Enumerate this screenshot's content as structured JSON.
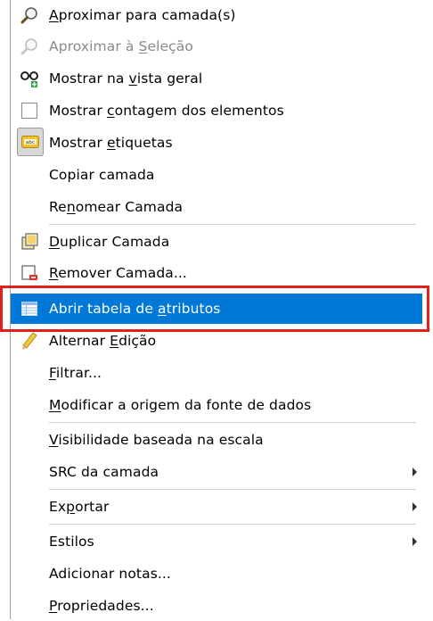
{
  "menu": {
    "items": [
      {
        "pre": "",
        "u": "A",
        "post": "proximar para camada(s)"
      },
      {
        "pre": "Aproximar à ",
        "u": "S",
        "post": "eleção"
      },
      {
        "pre": "Mostrar na ",
        "u": "v",
        "post": "ista geral"
      },
      {
        "pre": "Mostrar ",
        "u": "c",
        "post": "ontagem dos elementos"
      },
      {
        "pre": "Mostrar ",
        "u": "e",
        "post": "tiquetas"
      },
      {
        "pre": "Copiar camada",
        "u": "",
        "post": ""
      },
      {
        "pre": "Re",
        "u": "n",
        "post": "omear Camada"
      },
      {
        "pre": "",
        "u": "D",
        "post": "uplicar Camada"
      },
      {
        "pre": "",
        "u": "R",
        "post": "emover Camada..."
      },
      {
        "pre": "Abrir tabela de ",
        "u": "a",
        "post": "tributos"
      },
      {
        "pre": "Alternar ",
        "u": "E",
        "post": "dição"
      },
      {
        "pre": "",
        "u": "F",
        "post": "iltrar..."
      },
      {
        "pre": "",
        "u": "M",
        "post": "odificar a origem da fonte de dados"
      },
      {
        "pre": "",
        "u": "V",
        "post": "isibilidade baseada na escala"
      },
      {
        "pre": "SRC da camada",
        "u": "",
        "post": ""
      },
      {
        "pre": "Ex",
        "u": "p",
        "post": "ortar"
      },
      {
        "pre": "Estilos",
        "u": "",
        "post": ""
      },
      {
        "pre": "Adicionar notas...",
        "u": "",
        "post": ""
      },
      {
        "pre": "",
        "u": "P",
        "post": "ropriedades..."
      }
    ]
  },
  "colors": {
    "selected_bg": "#0078d7",
    "highlight_border": "#e0201a"
  }
}
